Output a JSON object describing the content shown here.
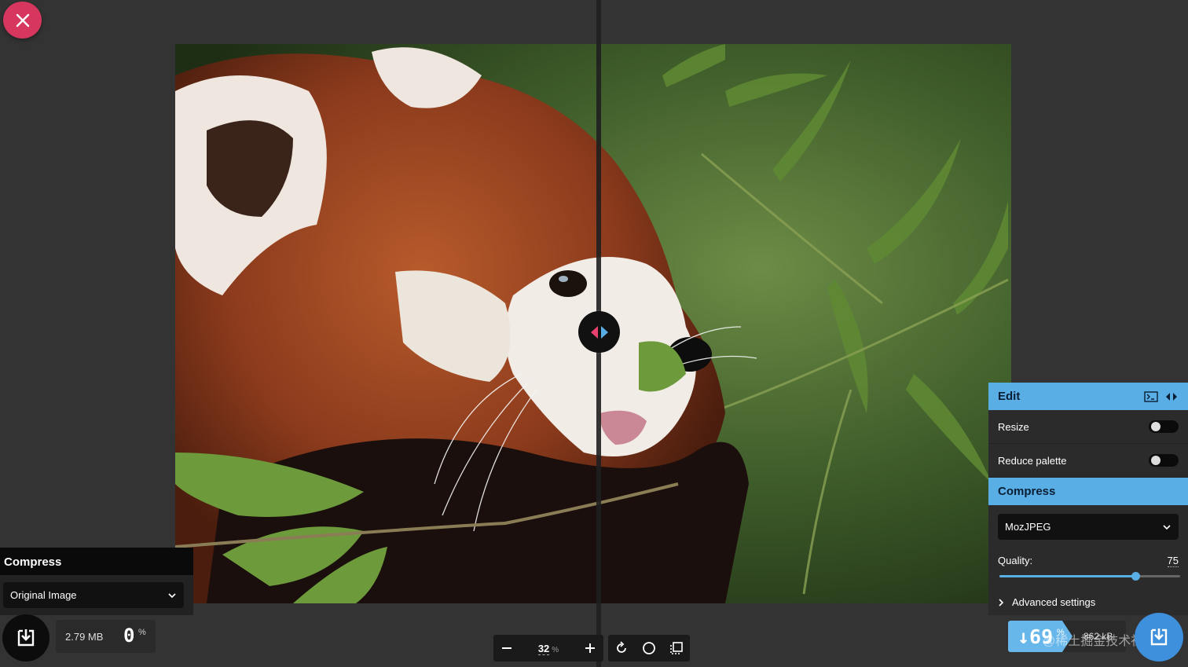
{
  "toolbar_left": {
    "close_icon": "close-icon"
  },
  "left_panel": {
    "title": "Compress",
    "method_selected": "Original Image"
  },
  "left_result": {
    "size": "2.79 MB",
    "percent": "0",
    "percent_sign": "%"
  },
  "zoom": {
    "value": "32",
    "unit": "%"
  },
  "right_panel": {
    "edit_title": "Edit",
    "resize_label": "Resize",
    "reduce_palette_label": "Reduce palette",
    "compress_title": "Compress",
    "method_selected": "MozJPEG",
    "quality_label": "Quality:",
    "quality_value": "75",
    "quality_fraction": 0.75,
    "advanced_label": "Advanced settings"
  },
  "right_result": {
    "percent": "↓69",
    "percent_sign": "%",
    "size": "862 kB"
  },
  "watermark": "@稀土掘金技术社区",
  "colors": {
    "accent_blue": "#5aaee6",
    "close_red": "#d7375f",
    "handle_left": "#e8416d",
    "handle_right": "#5aaee6"
  }
}
